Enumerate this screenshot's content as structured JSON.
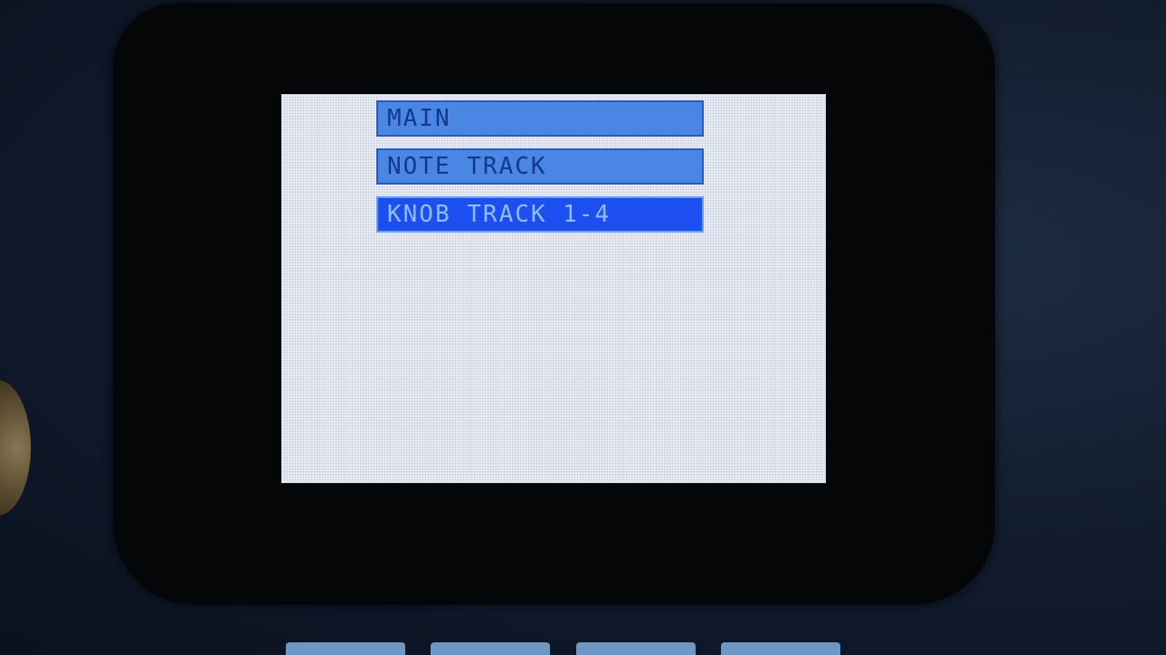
{
  "menu": {
    "items": [
      {
        "label": "MAIN",
        "selected": false
      },
      {
        "label": "NOTE TRACK",
        "selected": false
      },
      {
        "label": "KNOB TRACK 1-4",
        "selected": true
      }
    ]
  },
  "colors": {
    "screen_background": "#e8ebf3",
    "item_fill": "#4a86e4",
    "item_text": "#13398e",
    "selected_fill": "#1d4ff0",
    "selected_text": "#8fbdf7",
    "bezel": "#050608"
  }
}
